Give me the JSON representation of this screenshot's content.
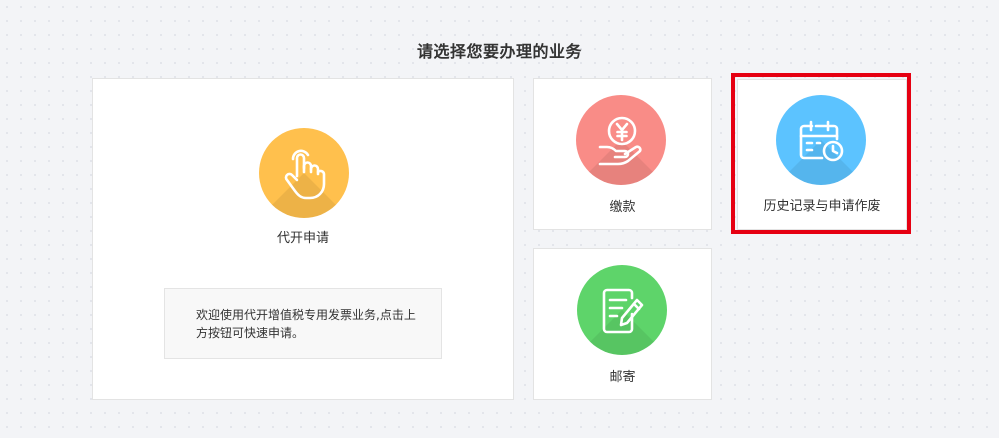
{
  "page": {
    "title": "请选择您要办理的业务"
  },
  "services": {
    "invoice": {
      "label": "代开申请",
      "notice": "欢迎使用代开增值税专用发票业务,点击上方按钮可快速申请。",
      "icon": "hand-pointer-icon",
      "color": "#ffc04d"
    },
    "payment": {
      "label": "缴款",
      "icon": "yen-hand-icon",
      "color": "#f98c87"
    },
    "history": {
      "label": "历史记录与申请作废",
      "icon": "calendar-clock-icon",
      "color": "#5cc3ff"
    },
    "mail": {
      "label": "邮寄",
      "icon": "edit-document-icon",
      "color": "#5ed46a"
    }
  },
  "highlight": {
    "color": "#e60012",
    "target": "history"
  }
}
